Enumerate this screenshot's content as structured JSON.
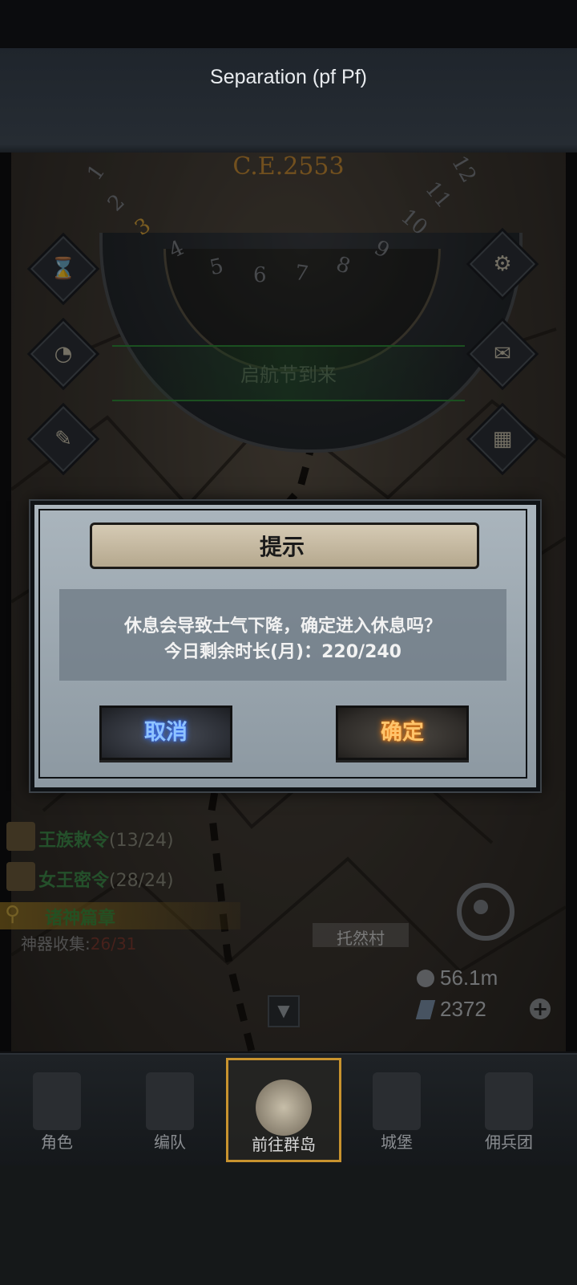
{
  "top_bar": {
    "title": "Separation (pf Pf)"
  },
  "calendar": {
    "year": "C.E.2553",
    "months": [
      "1",
      "2",
      "3",
      "4",
      "5",
      "6",
      "7",
      "8",
      "9",
      "10",
      "11",
      "12"
    ],
    "active_month": "3"
  },
  "event_banner": {
    "text": "启航节到来"
  },
  "side_icons": {
    "left": [
      "hourglass-icon",
      "money-bag-icon",
      "scroll-map-icon"
    ],
    "right": [
      "gear-icon",
      "mail-icon",
      "grid-icon"
    ]
  },
  "quests": [
    {
      "title": "王族敕令",
      "count": "(13/24)"
    },
    {
      "title": "女王密令",
      "count": "(28/24)"
    }
  ],
  "search": {
    "label": "诸神篇章"
  },
  "artifact": {
    "label": "神器收集:",
    "value": "26/31"
  },
  "map_labels": {
    "village": "托然村"
  },
  "resources": {
    "silver": "56.1m",
    "crystal": "2372"
  },
  "dialog": {
    "title": "提示",
    "message_line1": "休息会导致士气下降，确定进入休息吗？",
    "message_line2": "今日剩余时长(月)：220/240",
    "cancel_label": "取消",
    "confirm_label": "确定"
  },
  "nav": {
    "tabs": [
      {
        "label": "角色",
        "icon": "knight-icon"
      },
      {
        "label": "编队",
        "icon": "formation-icon"
      },
      {
        "label": "前往群岛",
        "icon": "globe-icon",
        "active": true
      },
      {
        "label": "城堡",
        "icon": "castle-icon"
      },
      {
        "label": "佣兵团",
        "icon": "mercenary-icon"
      }
    ]
  },
  "colors": {
    "dialog_bg": "#9aa6af",
    "cancel_text": "#8fc3ff",
    "confirm_text": "#ffc46b",
    "quest_green": "#3f8b4a",
    "active_tab_border": "#c8932e"
  }
}
